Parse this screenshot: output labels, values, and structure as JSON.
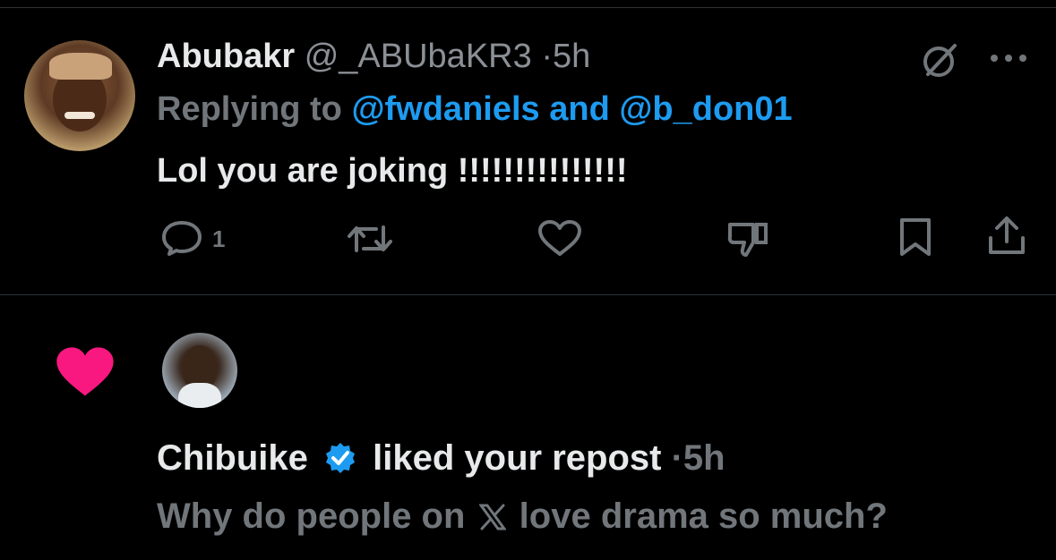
{
  "tweet": {
    "author_name": "Abubakr",
    "author_handle": "@_ABUbaKR3",
    "separator": "·",
    "time": "5h",
    "replying_prefix": "Replying to",
    "replying_user1": "@fwdaniels",
    "replying_and": "and",
    "replying_user2": "@b_don01",
    "text": "Lol you are joking !!!!!!!!!!!!!!!",
    "reply_count": "1",
    "icons": [
      "grok-icon",
      "more-icon",
      "reply-icon",
      "repost-icon",
      "like-icon",
      "dislike-icon",
      "bookmark-icon",
      "share-icon"
    ]
  },
  "notification": {
    "icon": "heart-icon",
    "user_name": "Chibuike",
    "verified": true,
    "action": "liked your repost",
    "separator": "·",
    "time": "5h",
    "post_text_before": "Why do people on",
    "post_text_after": "love drama so much?"
  },
  "colors": {
    "background": "#000000",
    "text": "#e7e9ea",
    "muted": "#71767b",
    "link": "#1d9bf0",
    "heart": "#f91880",
    "verified": "#1d9bf0"
  }
}
